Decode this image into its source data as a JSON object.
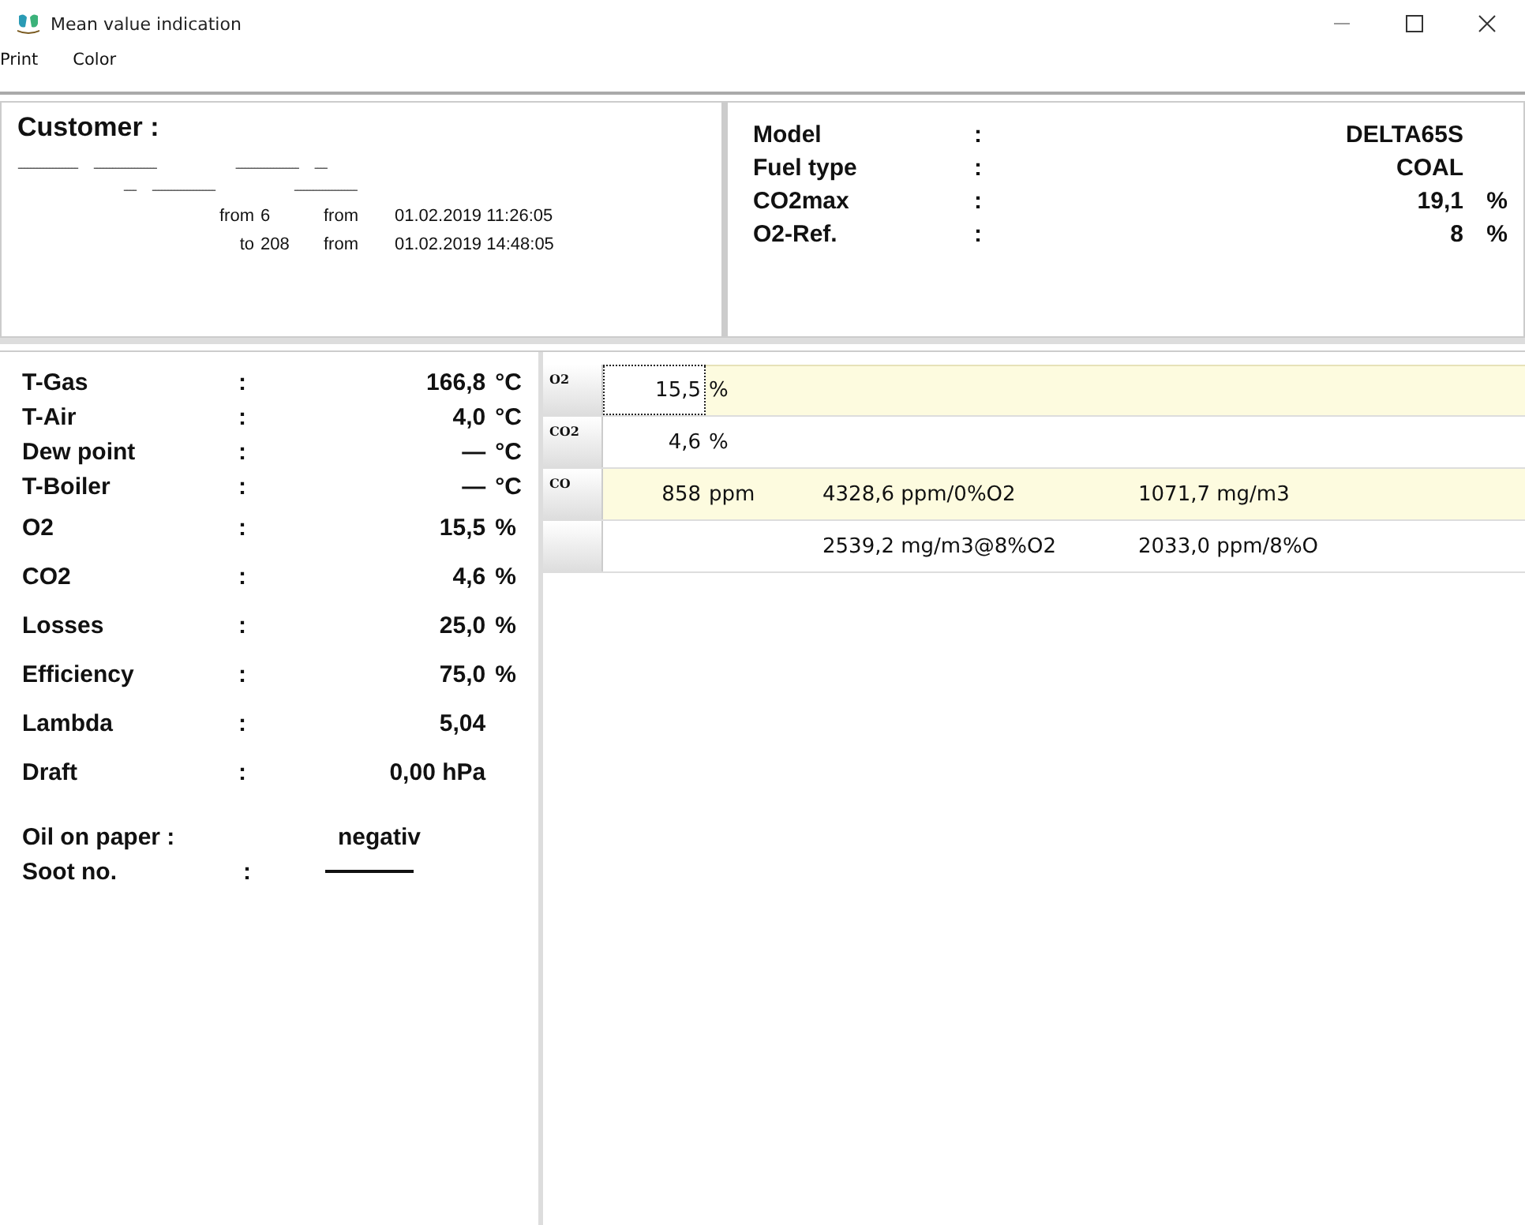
{
  "window": {
    "title": "Mean value indication"
  },
  "menu": [
    "Print",
    "Color"
  ],
  "customer": {
    "title": "Customer :",
    "line_1": [
      "-------------------",
      "--------------------",
      "--------------------",
      "----"
    ],
    "line_2": [
      "----",
      "--------------------",
      "--------------------"
    ],
    "range": [
      {
        "label": "from",
        "index": "6",
        "from": "from",
        "time": "01.02.2019 11:26:05"
      },
      {
        "label": "to",
        "index": "208",
        "from": "from",
        "time": "01.02.2019 14:48:05"
      }
    ]
  },
  "device": [
    {
      "label": "Model",
      "colon": ":",
      "value": "DELTA65S"
    },
    {
      "label": "Fuel type",
      "colon": ":",
      "value": "COAL"
    },
    {
      "label": "CO2max",
      "colon": ":",
      "value": "19,1",
      "unit": "%"
    },
    {
      "label": "O2-Ref.",
      "colon": ":",
      "value": "8",
      "unit": "%"
    }
  ],
  "measurements": [
    {
      "label": "T-Gas",
      "colon": ":",
      "value": "166,8",
      "unit": "°C"
    },
    {
      "label": "T-Air",
      "colon": ":",
      "value": "4,0",
      "unit": "°C"
    },
    {
      "label": "Dew point",
      "colon": ":",
      "value": "—",
      "unit": "°C"
    },
    {
      "label": "T-Boiler",
      "colon": ":",
      "value": "—",
      "unit": "°C"
    },
    {
      "label": "O2",
      "colon": ":",
      "value": "15,5",
      "unit": "%"
    },
    {
      "label": "CO2",
      "colon": ":",
      "value": "4,6",
      "unit": "%"
    },
    {
      "label": "Losses",
      "colon": ":",
      "value": "25,0",
      "unit": "%"
    },
    {
      "label": "Efficiency",
      "colon": ":",
      "value": "75,0",
      "unit": "%"
    },
    {
      "label": "Lambda",
      "colon": ":",
      "value": "5,04"
    },
    {
      "label": "Draft",
      "colon": ":",
      "value": "0,00 hPa"
    }
  ],
  "oil": {
    "label": "Oil on paper :",
    "value": "negativ"
  },
  "soot": {
    "label": "Soot no.",
    "colon": ":"
  },
  "grid": [
    {
      "header": "O2",
      "selected": true,
      "cells": [
        "15,5",
        "%",
        null,
        null
      ]
    },
    {
      "header": "CO2",
      "selected": false,
      "cells": [
        "4,6",
        "%",
        null,
        null
      ]
    },
    {
      "header": "CO",
      "selected": false,
      "cells": [
        "858",
        "ppm",
        "4328,6 ppm/0%O2",
        "1071,7 mg/m3"
      ]
    },
    {
      "selected": false,
      "cells": [
        null,
        null,
        "2539,2 mg/m3@8%O2",
        "2033,0 ppm/8%O"
      ]
    }
  ]
}
